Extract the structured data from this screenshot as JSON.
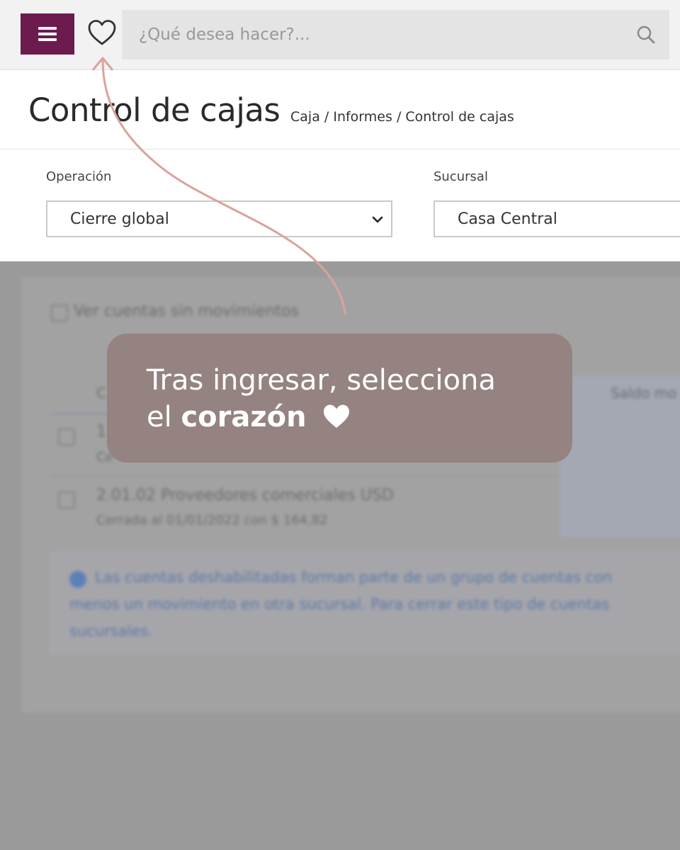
{
  "topbar": {
    "menu_icon": "hamburger-menu-icon",
    "favorites_icon": "heart-outline-icon",
    "search": {
      "placeholder": "¿Qué desea hacer?...",
      "value": "",
      "icon": "search-icon"
    },
    "brand_color": "#6d1a4e"
  },
  "header": {
    "title": "Control de cajas",
    "breadcrumb": [
      "Caja",
      "/",
      "Informes",
      "/",
      "Control de cajas"
    ]
  },
  "filters": {
    "operacion": {
      "label": "Operación",
      "value": "Cierre global"
    },
    "sucursal": {
      "label": "Sucursal",
      "value": "Casa Central"
    }
  },
  "background_content": {
    "checkbox_label": "Ver cuentas sin movimientos",
    "column_header_left": "C",
    "column_header_right": "Saldo mo",
    "row1": {
      "code": "1",
      "sub": "Ce"
    },
    "row2": {
      "title": "2.01.02 Proveedores comerciales USD",
      "sub": "Cerrada al 01/01/2022 con $ 164,82"
    },
    "info_text": [
      "Las cuentas deshabilitadas forman parte de un grupo de cuentas con",
      "menos un movimiento en otra sucursal. Para cerrar este tipo de cuentas",
      "sucursales."
    ]
  },
  "callout": {
    "line1": "Tras ingresar, selecciona",
    "line2_prefix": "el",
    "line2_bold": "corazón",
    "icon": "heart-filled-icon",
    "color": "#948380",
    "arrow_color": "#d9a39d"
  }
}
